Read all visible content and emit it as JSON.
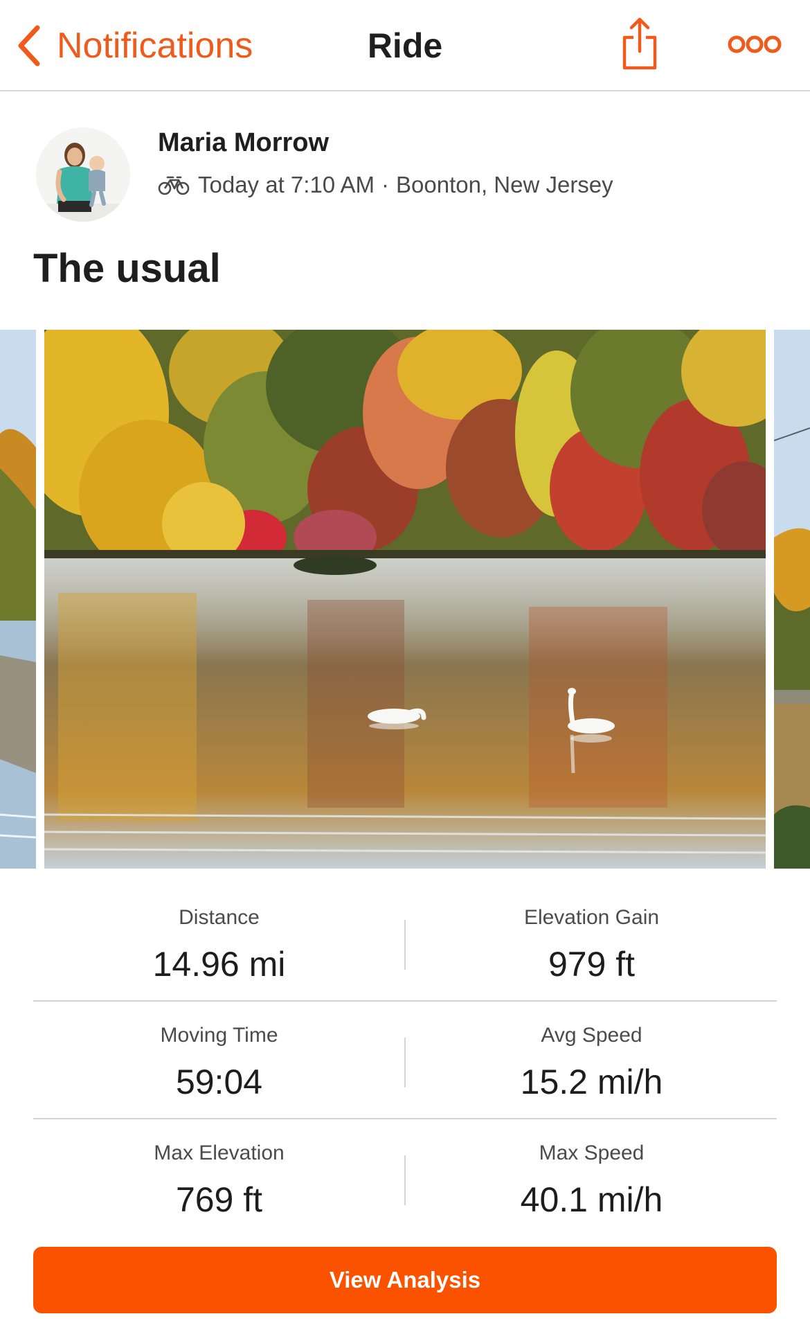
{
  "nav": {
    "back_label": "Notifications",
    "title": "Ride",
    "share_icon": "share-icon",
    "more_icon": "more-horizontal-icon"
  },
  "activity": {
    "athlete_name": "Maria Morrow",
    "sport_icon": "bike-icon",
    "time": "Today at 7:10 AM",
    "separator": "·",
    "location": "Boonton, New Jersey",
    "title": "The usual"
  },
  "photos": {
    "main_description_icon": "photo-lake-swans"
  },
  "stats": {
    "rows": [
      {
        "left": {
          "label": "Distance",
          "value": "14.96 mi"
        },
        "right": {
          "label": "Elevation Gain",
          "value": "979 ft"
        }
      },
      {
        "left": {
          "label": "Moving Time",
          "value": "59:04"
        },
        "right": {
          "label": "Avg Speed",
          "value": "15.2 mi/h"
        }
      },
      {
        "left": {
          "label": "Max Elevation",
          "value": "769 ft"
        },
        "right": {
          "label": "Max Speed",
          "value": "40.1 mi/h"
        }
      }
    ]
  },
  "actions": {
    "view_analysis": "View Analysis"
  },
  "colors": {
    "accent": "#fb5200",
    "nav_accent": "#f05a1a",
    "text": "#222222"
  }
}
